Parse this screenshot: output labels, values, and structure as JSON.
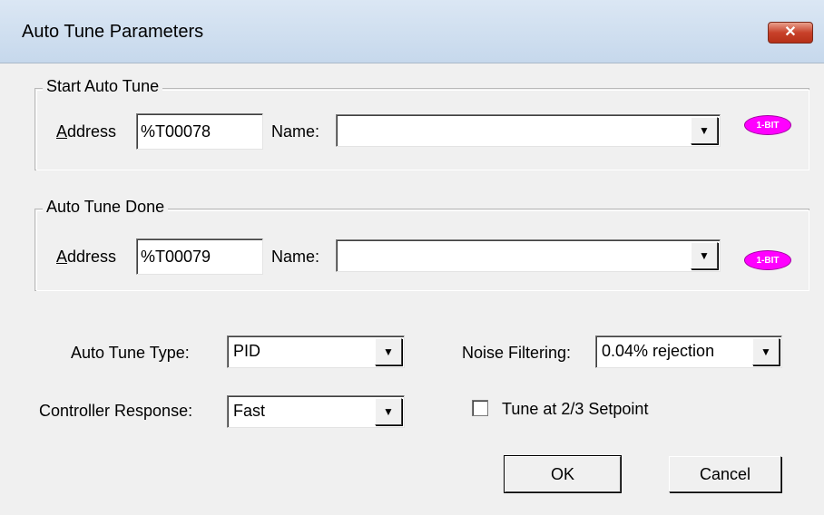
{
  "window": {
    "title": "Auto Tune Parameters",
    "close_glyph": "✕"
  },
  "start_group": {
    "title": "Start Auto Tune",
    "address_label_accel": "A",
    "address_label_rest": "ddress",
    "address_value": "%T00078",
    "name_label": "Name:",
    "name_value": "",
    "badge": "1-BIT"
  },
  "done_group": {
    "title": "Auto Tune Done",
    "address_label_accel": "A",
    "address_label_rest": "ddress",
    "address_value": "%T00079",
    "name_label": "Name:",
    "name_value": "",
    "badge": "1-BIT"
  },
  "tune_type": {
    "label": "Auto Tune Type:",
    "value": "PID"
  },
  "noise": {
    "label": "Noise Filtering:",
    "value": "0.04% rejection"
  },
  "response": {
    "label": "Controller Response:",
    "value": "Fast"
  },
  "setpoint_check": {
    "label": "Tune at 2/3 Setpoint",
    "checked": false
  },
  "buttons": {
    "ok": "OK",
    "cancel": "Cancel"
  },
  "icons": {
    "dropdown_arrow": "▼"
  },
  "colors": {
    "badge": "#ff00ff",
    "close_button": "#c8412a"
  }
}
